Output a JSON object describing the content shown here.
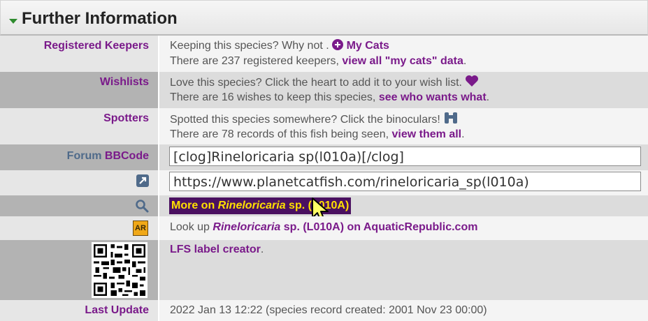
{
  "header": {
    "title": "Further Information"
  },
  "keepers": {
    "label": "Registered Keepers",
    "line1_prefix": "Keeping this species? Why not . ",
    "add_link": "My Cats",
    "line2_prefix": "There are 237 registered keepers, ",
    "view_link": "view all \"my cats\" data",
    "line2_suffix": "."
  },
  "wishlists": {
    "label": "Wishlists",
    "line1": "Love this species? Click the heart to add it to your wish list.",
    "line2_prefix": "There are 16 wishes to keep this species, ",
    "link": "see who wants what",
    "line2_suffix": "."
  },
  "spotters": {
    "label": "Spotters",
    "line1": "Spotted this species somewhere? Click the binoculars!",
    "line2_prefix": "There are 78 records of this fish being seen, ",
    "link": "view them all",
    "line2_suffix": "."
  },
  "forum": {
    "label_prefix": "Forum ",
    "label_highlight": "BBCode",
    "value": "[clog]Rineloricaria sp(l010a)[/clog]"
  },
  "permalink": {
    "value": "https://www.planetcatfish.com/rineloricaria_sp(l010a)"
  },
  "search": {
    "prefix": "More on ",
    "genus": "Rineloricaria",
    "suffix": " sp. (L010A)"
  },
  "aquatic": {
    "prefix": "Look up ",
    "genus": "Rineloricaria",
    "suffix": " sp. (L010A) on AquaticRepublic.com",
    "logo_text": "AR"
  },
  "lfs": {
    "link": "LFS label creator",
    "suffix": "."
  },
  "update": {
    "label": "Last Update",
    "value": "2022 Jan 13 12:22 (species record created: 2001 Nov 23 00:00)"
  },
  "colors": {
    "accent": "#7a1a8a",
    "highlight_bg": "#4a1060",
    "highlight_fg": "#ffe000",
    "label_slate": "#4f6a8a"
  }
}
